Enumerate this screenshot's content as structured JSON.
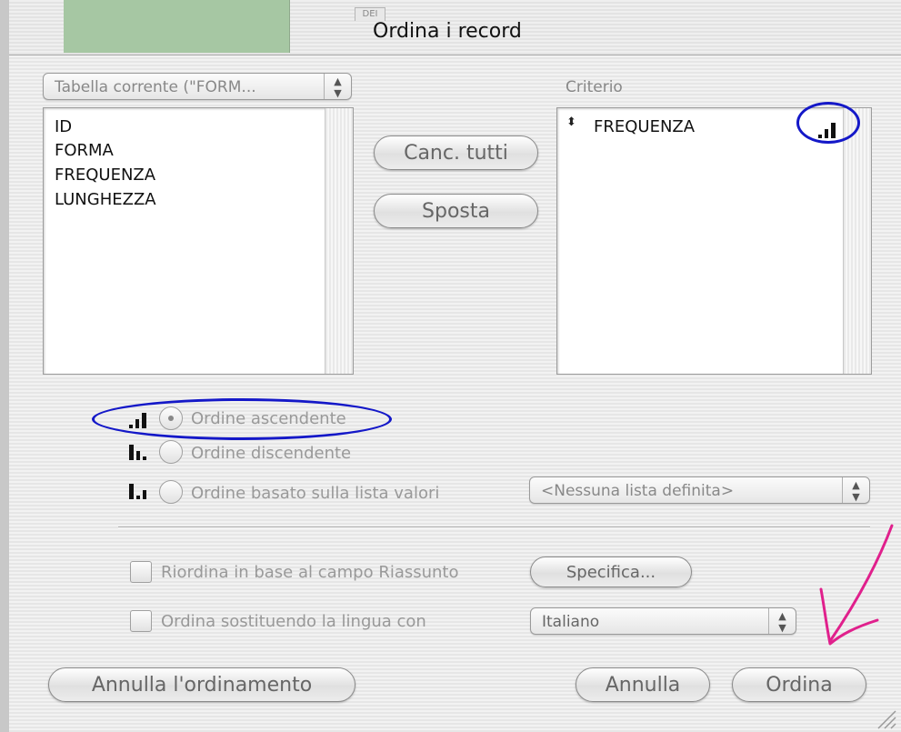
{
  "window": {
    "title": "Ordina i record",
    "background_tab_label": "DEI"
  },
  "table_popup": {
    "value": "Tabella corrente (\"FORM...",
    "stepper_icon": "up-down-arrows"
  },
  "fields": [
    "ID",
    "FORMA",
    "FREQUENZA",
    "LUNGHEZZA"
  ],
  "buttons": {
    "clear_all": "Canc. tutti",
    "move": "Sposta",
    "unsort": "Annulla l'ordinamento",
    "cancel": "Annulla",
    "sort": "Ordina",
    "specify": "Specifica..."
  },
  "criteria": {
    "label": "Criterio",
    "items": [
      {
        "field": "FREQUENZA",
        "order": "ascending"
      }
    ]
  },
  "sort_order": {
    "ascending": "Ordine ascendente",
    "descending": "Ordine discendente",
    "value_list": "Ordine basato sulla lista valori",
    "selected": "ascending"
  },
  "value_list_popup": {
    "value": "<Nessuna lista definita>"
  },
  "options": {
    "reorder_summary": {
      "label": "Riordina in base al campo Riassunto",
      "checked": false
    },
    "language": {
      "label": "Ordina sostituendo la lingua con",
      "checked": false,
      "value": "Italiano"
    }
  },
  "colors": {
    "annotation_circle": "#1418c8",
    "annotation_arrow": "#e0208c",
    "title_green": "#a6c7a3"
  }
}
